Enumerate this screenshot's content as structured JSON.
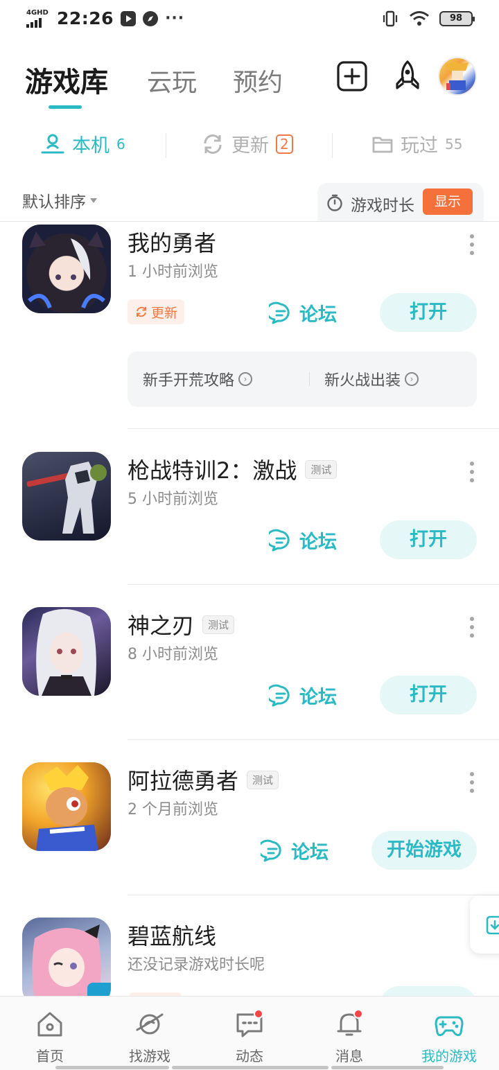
{
  "status_bar": {
    "network": "4GHD",
    "time": "22:26",
    "more": "···",
    "battery": "98"
  },
  "header": {
    "tabs": [
      {
        "label": "游戏库",
        "active": true
      },
      {
        "label": "云玩",
        "active": false
      },
      {
        "label": "预约",
        "active": false
      }
    ],
    "icons": [
      "add-square-icon",
      "rocket-icon",
      "avatar"
    ]
  },
  "sub_tabs": [
    {
      "label": "本机",
      "count": "6",
      "icon": "phone-user-icon",
      "active": true
    },
    {
      "label": "更新",
      "count": "2",
      "icon": "refresh-icon",
      "active": false
    },
    {
      "label": "玩过",
      "count": "55",
      "icon": "folder-icon",
      "active": false
    }
  ],
  "sort_bar": {
    "sort_label": "默认排序",
    "playtime_label": "游戏时长",
    "show_button": "显示"
  },
  "games": [
    {
      "name": "我的勇者",
      "test_tag": "",
      "subtitle": "1 小时前浏览",
      "update_tag": "更新",
      "forum": "论坛",
      "action": "打开",
      "guides": [
        "新手开荒攻略",
        "新火战出装"
      ]
    },
    {
      "name": "枪战特训2：激战",
      "test_tag": "测试",
      "subtitle": "5 小时前浏览",
      "forum": "论坛",
      "action": "打开"
    },
    {
      "name": "神之刃",
      "test_tag": "测试",
      "subtitle": "8 小时前浏览",
      "forum": "论坛",
      "action": "打开"
    },
    {
      "name": "阿拉德勇者",
      "test_tag": "测试",
      "subtitle": "2 个月前浏览",
      "forum": "论坛",
      "action": "开始游戏"
    },
    {
      "name": "碧蓝航线",
      "test_tag": "",
      "subtitle": "还没记录游戏时长呢"
    }
  ],
  "bottom_nav": [
    {
      "label": "首页",
      "icon": "home-icon",
      "dot": false
    },
    {
      "label": "找游戏",
      "icon": "planet-icon",
      "dot": false
    },
    {
      "label": "动态",
      "icon": "chat-icon",
      "dot": true
    },
    {
      "label": "消息",
      "icon": "bell-icon",
      "dot": true
    },
    {
      "label": "我的游戏",
      "icon": "gamepad-icon",
      "dot": false,
      "active": true
    }
  ],
  "colors": {
    "accent": "#2bbac4",
    "accent_light": "#e6f7f8",
    "orange": "#f5703b",
    "badge_red": "#f2474a"
  }
}
